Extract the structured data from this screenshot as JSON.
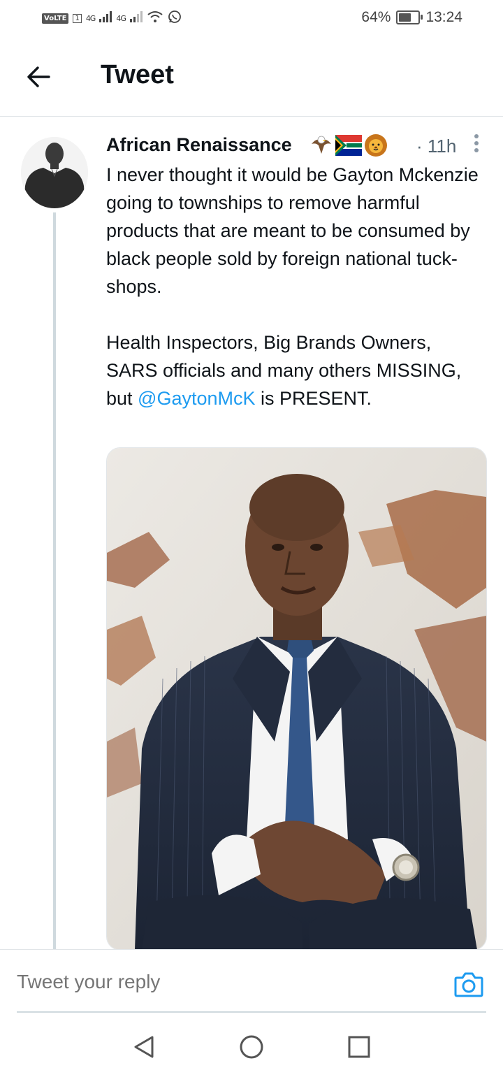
{
  "status_bar": {
    "volte": "VoLTE",
    "sim": "1",
    "net1": "4G",
    "net2": "4G",
    "battery_percent": "64%",
    "battery_level": 0.64,
    "time": "13:24"
  },
  "header": {
    "title": "Tweet",
    "back_icon": "arrow-left-icon"
  },
  "tweet": {
    "author": "African Renaissance",
    "emojis": [
      "eagle",
      "south-africa-flag",
      "lion"
    ],
    "time": "· 11h",
    "paragraph1": "I never thought it would be Gayton Mckenzie going to townships to remove harmful products that are meant to be consumed by black people sold by foreign national tuck-shops.",
    "paragraph2_before": "Health Inspectors, Big Brands Owners, SARS officials and many others MISSING, but ",
    "mention": "@GaytonMcK",
    "paragraph2_after": " is PRESENT."
  },
  "reply": {
    "placeholder": "Tweet your reply",
    "camera_icon": "camera-icon"
  },
  "nav": {
    "back_icon": "nav-back-icon",
    "home_icon": "nav-home-icon",
    "recents_icon": "nav-recents-icon"
  },
  "colors": {
    "accent": "#1d9bf0",
    "text": "#0f1419",
    "secondary": "#536471",
    "divider": "#e1e5e8"
  }
}
